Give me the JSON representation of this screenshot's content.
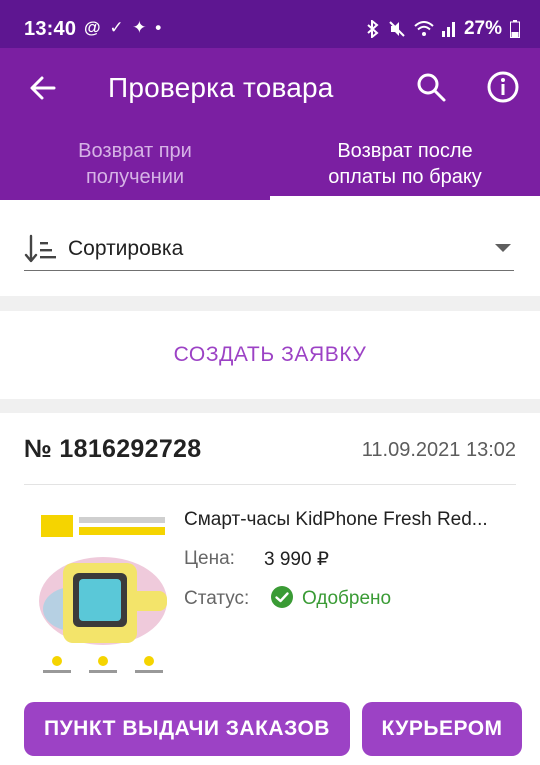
{
  "status_bar": {
    "time": "13:40",
    "left_icons": [
      "@",
      "✓",
      "✦",
      "•"
    ],
    "battery": "27%"
  },
  "header": {
    "title": "Проверка товара",
    "tabs": [
      {
        "label": "Возврат при получении",
        "line1": "Возврат при",
        "line2": "получении",
        "selected": false
      },
      {
        "label": "Возврат после оплаты по браку",
        "line1": "Возврат после",
        "line2": "оплаты по браку",
        "selected": true
      }
    ]
  },
  "sort": {
    "label": "Сортировка"
  },
  "create": {
    "label": "СОЗДАТЬ ЗАЯВКУ"
  },
  "order": {
    "number": "№ 1816292728",
    "date": "11.09.2021 13:02",
    "product": {
      "name": "Смарт-часы KidPhone Fresh Red...",
      "price_label": "Цена:",
      "price": "3 990 ₽",
      "status_label": "Статус:",
      "status": "Одобрено"
    },
    "actions": {
      "pickup": "ПУНКТ ВЫДАЧИ ЗАКАЗОВ",
      "courier": "КУРЬЕРОМ"
    }
  },
  "colors": {
    "status_bar": "#5e1691",
    "app_bar": "#7b1fa2",
    "accent": "#9c42c5",
    "approved": "#3a9b35"
  }
}
